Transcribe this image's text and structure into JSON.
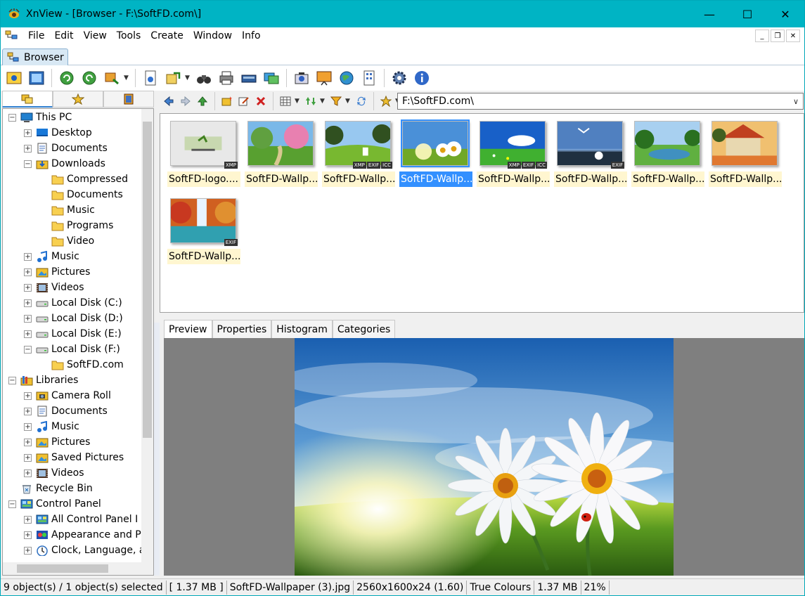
{
  "window": {
    "title": "XnView - [Browser - F:\\SoftFD.com\\]",
    "accent": "#00b4c4",
    "controls": {
      "minimize": "—",
      "maximize": "☐",
      "close": "✕"
    }
  },
  "menu": {
    "items": [
      "File",
      "Edit",
      "View",
      "Tools",
      "Create",
      "Window",
      "Info"
    ],
    "mdi": {
      "minimize": "_",
      "restore": "❐",
      "close": "✕"
    }
  },
  "tabs": {
    "browser": "Browser"
  },
  "address": {
    "value": "F:\\SoftFD.com\\"
  },
  "tree": [
    {
      "label": "This PC",
      "level": 0,
      "exp": "−",
      "icon": "pc"
    },
    {
      "label": "Desktop",
      "level": 1,
      "exp": "+",
      "icon": "desktop"
    },
    {
      "label": "Documents",
      "level": 1,
      "exp": "+",
      "icon": "docs"
    },
    {
      "label": "Downloads",
      "level": 1,
      "exp": "−",
      "icon": "downloads"
    },
    {
      "label": "Compressed",
      "level": 2,
      "exp": "",
      "icon": "folder"
    },
    {
      "label": "Documents",
      "level": 2,
      "exp": "",
      "icon": "folder"
    },
    {
      "label": "Music",
      "level": 2,
      "exp": "",
      "icon": "folder"
    },
    {
      "label": "Programs",
      "level": 2,
      "exp": "",
      "icon": "folder"
    },
    {
      "label": "Video",
      "level": 2,
      "exp": "",
      "icon": "folder"
    },
    {
      "label": "Music",
      "level": 1,
      "exp": "+",
      "icon": "music"
    },
    {
      "label": "Pictures",
      "level": 1,
      "exp": "+",
      "icon": "pictures"
    },
    {
      "label": "Videos",
      "level": 1,
      "exp": "+",
      "icon": "videos"
    },
    {
      "label": "Local Disk (C:)",
      "level": 1,
      "exp": "+",
      "icon": "disk"
    },
    {
      "label": "Local Disk (D:)",
      "level": 1,
      "exp": "+",
      "icon": "disk"
    },
    {
      "label": "Local Disk (E:)",
      "level": 1,
      "exp": "+",
      "icon": "disk"
    },
    {
      "label": "Local Disk (F:)",
      "level": 1,
      "exp": "−",
      "icon": "disk"
    },
    {
      "label": "SoftFD.com",
      "level": 2,
      "exp": "",
      "icon": "folder"
    },
    {
      "label": "Libraries",
      "level": 0,
      "exp": "−",
      "icon": "libraries"
    },
    {
      "label": "Camera Roll",
      "level": 1,
      "exp": "+",
      "icon": "camera"
    },
    {
      "label": "Documents",
      "level": 1,
      "exp": "+",
      "icon": "docs"
    },
    {
      "label": "Music",
      "level": 1,
      "exp": "+",
      "icon": "music"
    },
    {
      "label": "Pictures",
      "level": 1,
      "exp": "+",
      "icon": "pictures"
    },
    {
      "label": "Saved Pictures",
      "level": 1,
      "exp": "+",
      "icon": "pictures"
    },
    {
      "label": "Videos",
      "level": 1,
      "exp": "+",
      "icon": "videos"
    },
    {
      "label": "Recycle Bin",
      "level": 0,
      "exp": "",
      "icon": "recycle"
    },
    {
      "label": "Control Panel",
      "level": 0,
      "exp": "−",
      "icon": "control"
    },
    {
      "label": "All Control Panel I",
      "level": 1,
      "exp": "+",
      "icon": "control"
    },
    {
      "label": "Appearance and P",
      "level": 1,
      "exp": "+",
      "icon": "appearance"
    },
    {
      "label": "Clock, Language, a",
      "level": 1,
      "exp": "+",
      "icon": "clock"
    }
  ],
  "thumbnails": [
    {
      "label": "SoftFD-logo....",
      "badges": [
        "XMP"
      ],
      "theme": "logo"
    },
    {
      "label": "SoftFD-Wallp...",
      "badges": [],
      "theme": "spring"
    },
    {
      "label": "SoftFD-Wallp...",
      "badges": [
        "XMP",
        "EXIF",
        "ICC"
      ],
      "theme": "meadow"
    },
    {
      "label": "SoftFD-Wallp...",
      "badges": [],
      "theme": "daisy",
      "selected": true
    },
    {
      "label": "SoftFD-Wallp...",
      "badges": [
        "XMP",
        "EXIF",
        "ICC"
      ],
      "theme": "field"
    },
    {
      "label": "SoftFD-Wallp...",
      "badges": [
        "EXIF"
      ],
      "theme": "bird"
    },
    {
      "label": "SoftFD-Wallp...",
      "badges": [],
      "theme": "lake"
    },
    {
      "label": "SoftFD-Wallp...",
      "badges": [],
      "theme": "house"
    },
    {
      "label": "SoftFD-Wallp...",
      "badges": [
        "EXIF"
      ],
      "theme": "waterfall"
    }
  ],
  "preview_tabs": [
    "Preview",
    "Properties",
    "Histogram",
    "Categories"
  ],
  "status": {
    "objects": "9 object(s) / 1 object(s) selected",
    "size": "[ 1.37 MB ]",
    "filename": "SoftFD-Wallpaper (3).jpg",
    "dimensions": "2560x1600x24 (1.60)",
    "colours": "True Colours",
    "filesize": "1.37 MB",
    "zoom": "21%"
  }
}
